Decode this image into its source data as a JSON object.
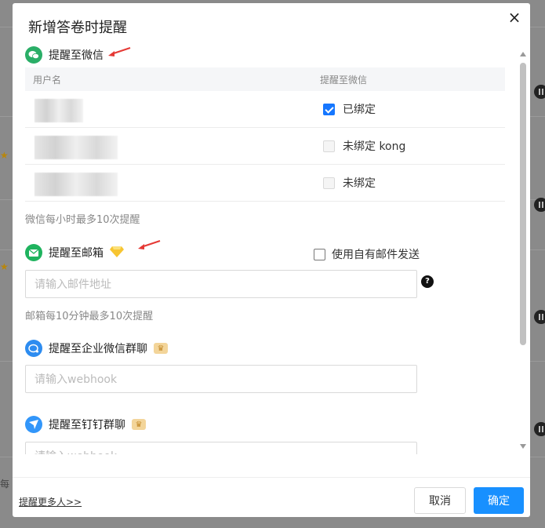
{
  "dialog": {
    "title": "新增答卷时提醒",
    "close_icon": "×"
  },
  "wechat": {
    "label": "提醒至微信",
    "icon": "wechat-icon",
    "columns": [
      "用户名",
      "提醒至微信"
    ],
    "rows": [
      {
        "status": "已绑定",
        "checked": true
      },
      {
        "status": "未绑定 kong",
        "checked": false
      },
      {
        "status": "未绑定",
        "checked": false
      }
    ],
    "hint": "微信每小时最多10次提醒"
  },
  "email": {
    "label": "提醒至邮箱",
    "icon": "mail-icon",
    "own_mail_label": "使用自有邮件发送",
    "placeholder": "请输入邮件地址",
    "help_icon": "?",
    "hint": "邮箱每10分钟最多10次提醒"
  },
  "wecom": {
    "label": "提醒至企业微信群聊",
    "icon": "wecom-icon",
    "placeholder": "请输入webhook"
  },
  "dingtalk": {
    "label": "提醒至钉钉群聊",
    "icon": "dingtalk-icon",
    "placeholder": "请输入webhook"
  },
  "footer": {
    "more_link": "提醒更多人>>",
    "cancel_label": "取消",
    "ok_label": "确定"
  },
  "background": {
    "partial_text": "每"
  },
  "colors": {
    "primary": "#1890ff",
    "wechat_green": "#2aae67",
    "mail_green": "#1fb35e",
    "wecom_blue": "#2d8cf0",
    "dingtalk_blue": "#3296fa"
  }
}
